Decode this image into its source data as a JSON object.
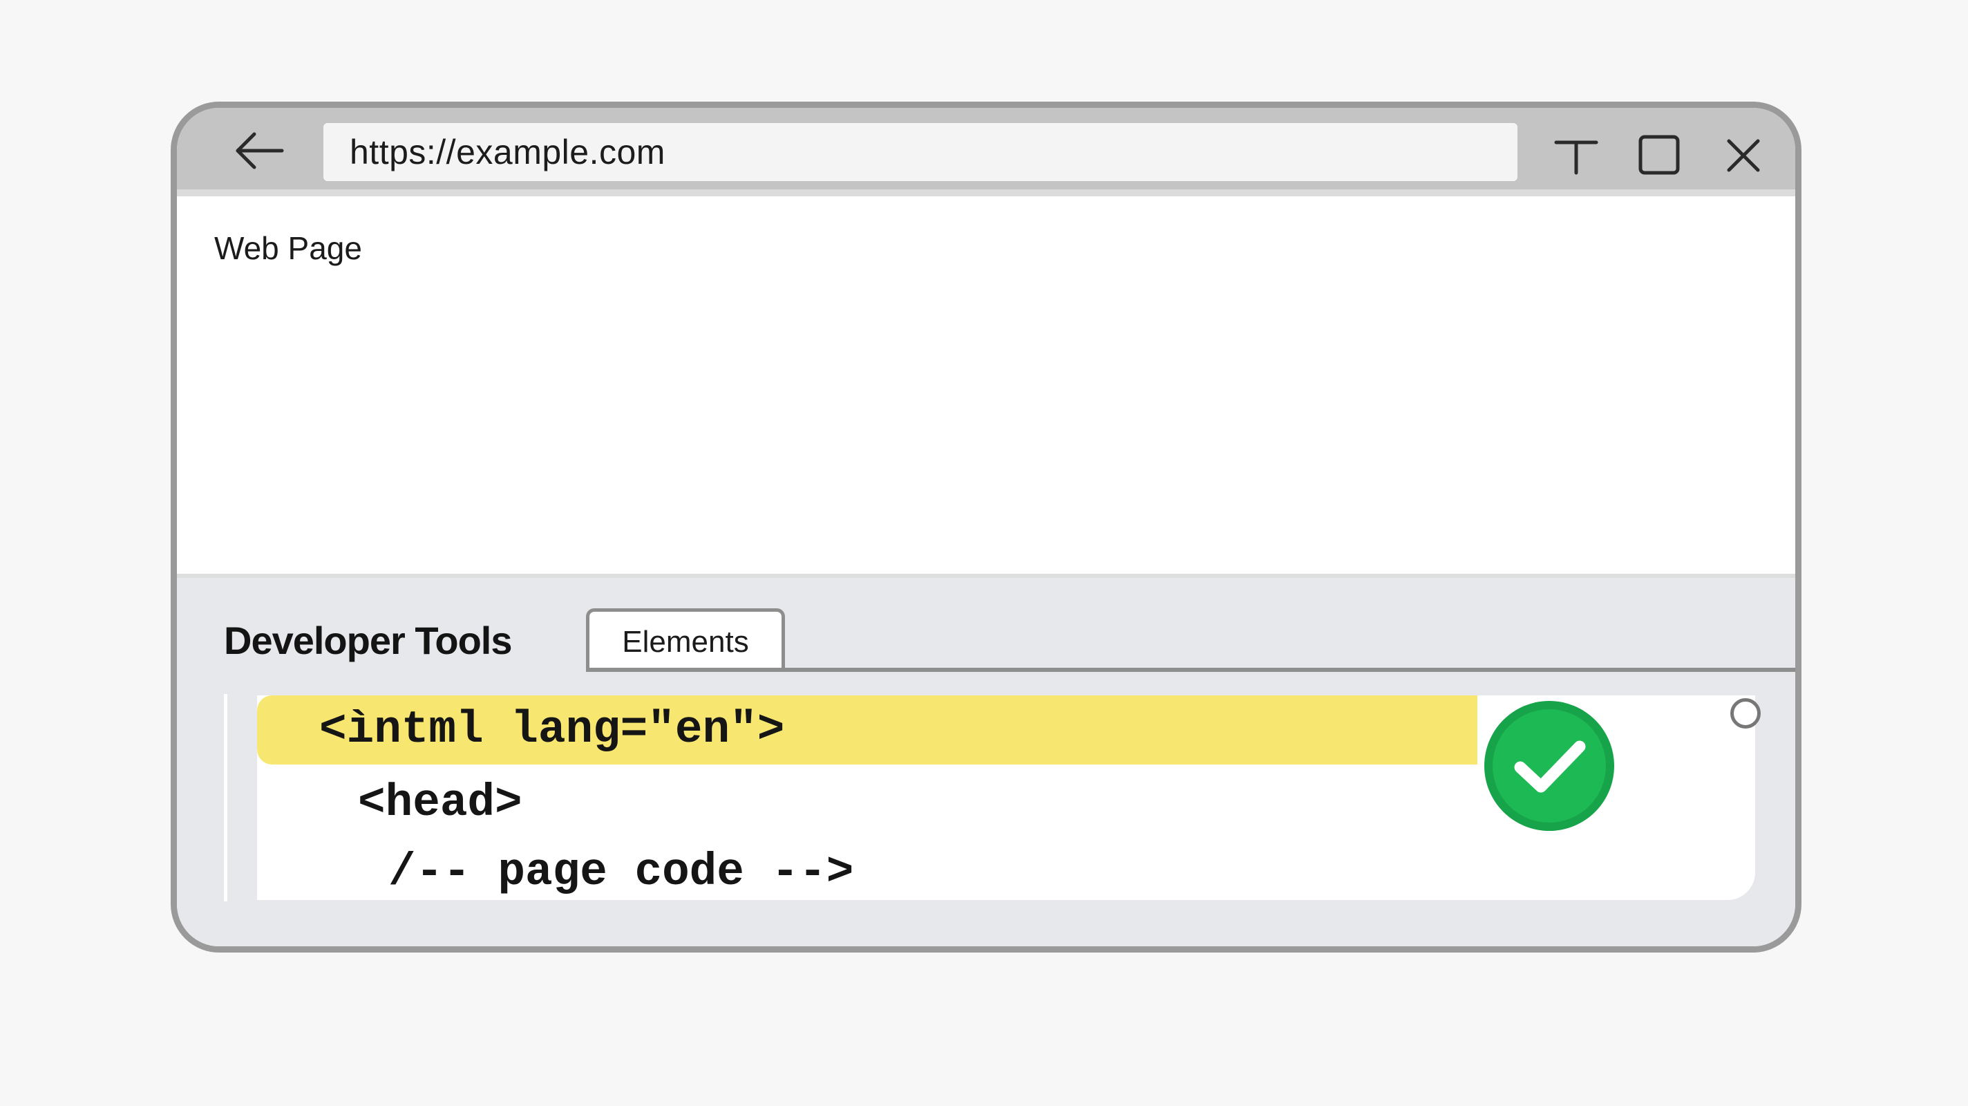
{
  "browser": {
    "url": "https://example.com",
    "icons": {
      "back": "arrow-left-icon",
      "minimize": "minimize-icon",
      "maximize": "maximize-icon",
      "close": "close-icon"
    }
  },
  "page": {
    "label": "Web Page"
  },
  "devtools": {
    "title": "Developer Tools",
    "tabs": [
      {
        "label": "Elements",
        "active": true
      }
    ],
    "code_lines": [
      {
        "text": "<ìntml lang=\"en\">",
        "selected": true
      },
      {
        "text": "<head>",
        "selected": false
      },
      {
        "text": "/-- page code -->",
        "selected": false
      }
    ],
    "status_icon": "check-circle-icon",
    "colors": {
      "highlight": "#f7e66f",
      "check_green": "#1db954",
      "devtools_bg": "#e6e8eb"
    }
  }
}
